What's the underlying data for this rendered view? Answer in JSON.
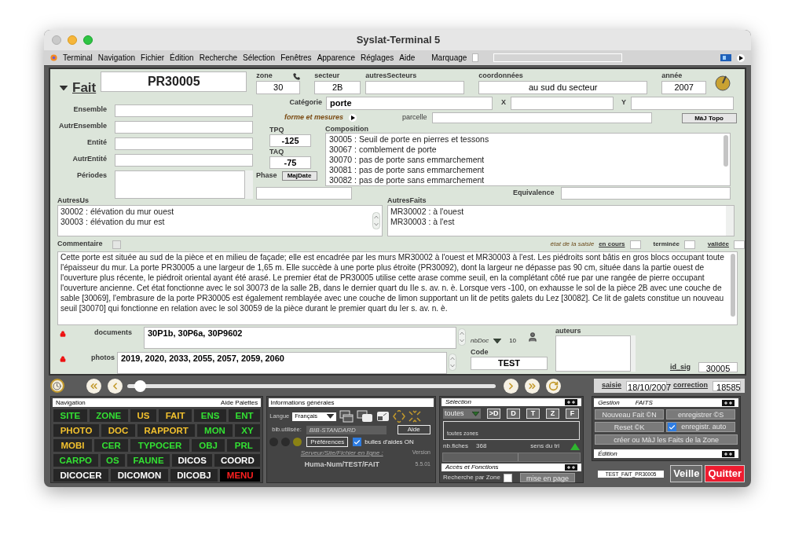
{
  "window": {
    "title": "Syslat-Terminal 5"
  },
  "menu": {
    "items": [
      "Terminal",
      "Navigation",
      "Fichier",
      "Édition",
      "Recherche",
      "Sélection",
      "Fenêtres",
      "Apparence",
      "Réglages",
      "Aide"
    ],
    "marquage": {
      "label": "Marquage",
      "checked": false
    }
  },
  "header": {
    "section": "Fait",
    "record": "PR30005",
    "fields": [
      {
        "label": "zone",
        "value": "30"
      },
      {
        "label": "secteur",
        "value": "2B"
      },
      {
        "label": "autresSecteurs"
      },
      {
        "label": "coordonnées",
        "value": "au sud du secteur"
      },
      {
        "label": "année",
        "value": "2007"
      }
    ]
  },
  "left_fields": [
    {
      "label": "Ensemble"
    },
    {
      "label": "AutrEnsemble"
    },
    {
      "label": "Entité"
    },
    {
      "label": "AutrEntité"
    },
    {
      "label": "Périodes"
    }
  ],
  "categorie": {
    "label": "Catégorie",
    "value": "porte"
  },
  "x": {
    "label": "X"
  },
  "y": {
    "label": "Y"
  },
  "forme": "forme et mesures",
  "parcelle": {
    "label": "parcelle"
  },
  "maj_topo": "MàJ Topo",
  "dates": [
    {
      "label": "TPQ",
      "value": "-125"
    },
    {
      "label": "TAQ",
      "value": "-75"
    }
  ],
  "maj_date": "MajDate",
  "phase": {
    "label": "Phase"
  },
  "composition": {
    "label": "Composition",
    "items": [
      "30005 : Seuil de porte en pierres et tessons",
      "30067 : comblement de porte",
      "30070 : pas de porte sans emmarchement",
      "30081 : pas de porte sans emmarchement",
      "30082 : pas de porte sans emmarchement"
    ]
  },
  "equivalence": {
    "label": "Equivalence"
  },
  "autres_us": {
    "label": "AutresUs",
    "items": [
      "30002 : élévation du mur ouest",
      "30003 : élévation du mur est"
    ]
  },
  "autres_faits": {
    "label": "AutresFaits",
    "items": [
      "MR30002 : à l'ouest",
      "MR30003 : à l'est"
    ]
  },
  "commentaire": {
    "label": "Commentaire",
    "checked": false,
    "text": "Cette porte est située au sud de la pièce et en milieu de façade; elle est encadrée par les murs MR30002 à l'ouest et MR30003 à l'est. Les piédroits sont bâtis en gros blocs occupant toute l'épaisseur du mur. La porte PR30005 a une largeur de 1,65 m. Elle succède à une porte plus étroite (PR30092), dont la largeur ne dépasse pas 90 cm, située dans la partie ouest de l'ouverture plus récente, le piédroit oriental ayant été arasé. Le premier état de PR30005 utilise cette arase comme seuil, en la complétant côté rue par une rangée de pierre occupant l'ouverture ancienne. Cet état fonctionne avec le sol 30073 de la salle 2B, dans le dernier quart du IIe s. av. n. è. Lorsque vers -100, on exhausse le sol de la pièce 2B avec une couche de sable [30069], l'embrasure de la porte PR30005 est également remblayée avec une couche de limon supportant un lit de petits galets du Lez [30082]. Ce lit de galets constitue un nouveau seuil [30070] qui fonctionne en relation avec le sol 30059 de la pièce durant le premier quart du Ier s. av. n. è."
  },
  "etat": {
    "label": "état de la saisie",
    "options": [
      {
        "label": "en cours",
        "checked": false
      },
      {
        "label": "terminée",
        "checked": false
      },
      {
        "label": "validée",
        "checked": false
      }
    ]
  },
  "documents": {
    "label": "documents",
    "value": "30P1b, 30P6a, 30P9602"
  },
  "photos": {
    "label": "photos",
    "value": "2019, 2020, 2033, 2055, 2057, 2059, 2060"
  },
  "nb_doc": {
    "label": "nbDoc",
    "value": "10"
  },
  "code": {
    "label": "Code",
    "value": "TEST"
  },
  "auteurs": {
    "label": "auteurs"
  },
  "id_sig": {
    "label": "id_sig",
    "value": "30005"
  },
  "toolbar": {
    "slider": {
      "level": 0.02
    },
    "saisie": {
      "label": "saisie",
      "value": "18/10/2007"
    },
    "correction": {
      "label": "correction",
      "value": "18585"
    }
  },
  "navigation": {
    "title": "Navigation",
    "help": "Aide Palettes",
    "buttons": [
      {
        "label": "SITE",
        "kind": "record"
      },
      {
        "label": "ZONE",
        "kind": "record"
      },
      {
        "label": "US",
        "kind": "document"
      },
      {
        "label": "FAIT",
        "kind": "document"
      },
      {
        "label": "ENS",
        "kind": "record"
      },
      {
        "label": "ENT",
        "kind": "record"
      },
      {
        "label": "PHOTO",
        "kind": "document"
      },
      {
        "label": "DOC",
        "kind": "document"
      },
      {
        "label": "RAPPORT",
        "kind": "document"
      },
      {
        "label": "MON",
        "kind": "record"
      },
      {
        "label": "XY",
        "kind": "record"
      },
      {
        "label": "MOBI",
        "kind": "document"
      },
      {
        "label": "CER",
        "kind": "record"
      },
      {
        "label": "TYPOCER",
        "kind": "record"
      },
      {
        "label": "OBJ",
        "kind": "record"
      },
      {
        "label": "PRL",
        "kind": "record"
      },
      {
        "label": "CARPO",
        "kind": "record"
      },
      {
        "label": "OS",
        "kind": "record"
      },
      {
        "label": "FAUNE",
        "kind": "record"
      },
      {
        "label": "DICOS",
        "kind": "dictionary"
      },
      {
        "label": "COORD",
        "kind": "dictionary"
      },
      {
        "label": "DICOCER",
        "kind": "dictionary"
      },
      {
        "label": "DICOMON",
        "kind": "dictionary"
      },
      {
        "label": "DICOBJ",
        "kind": "dictionary"
      },
      {
        "label": "MENU",
        "kind": "menu"
      }
    ]
  },
  "infos": {
    "title": "Informations générales",
    "langue": {
      "label": "Langue",
      "value": "Français"
    },
    "bib": {
      "label": "bib.utilisée:",
      "value": "BIB-STANDARD"
    },
    "aide": "Aide",
    "preferences": "Préférences",
    "bulles": {
      "label": "bulles d'aides ON",
      "checked": true
    },
    "link": "Serveur/Site/Fichier en ligne :",
    "path": "Huma-Num/TEST/FAIT",
    "version": {
      "label": "Version",
      "value": "5.5.01"
    }
  },
  "selection": {
    "title": "Sélection",
    "dropdown": "toutes",
    "buttons": [
      ">D",
      "D",
      "T",
      "Z",
      "F"
    ],
    "list": "toutes zones",
    "nb_fiches": {
      "label": "nb.fiches",
      "value": "368"
    },
    "tri": "sens du tri"
  },
  "acces": {
    "title": "Accès et Fonctions",
    "recherche": {
      "label": "Recherche par Zone",
      "checked": false
    },
    "mise_en_page": "mise en page"
  },
  "gestion": {
    "title": "Gestion",
    "table": "FAITS",
    "nouveau": "Nouveau Fait ©N",
    "enregistrer": "enregistrer ©S",
    "reset": "Reset ©K",
    "auto": {
      "label": "enregistr. auto",
      "checked": true
    },
    "creer": "créer ou MàJ les Faits de la Zone",
    "edition": "Édition"
  },
  "record_file": "TEST_FAIT_PR30005",
  "veille": "Veille",
  "quitter": "Quitter"
}
